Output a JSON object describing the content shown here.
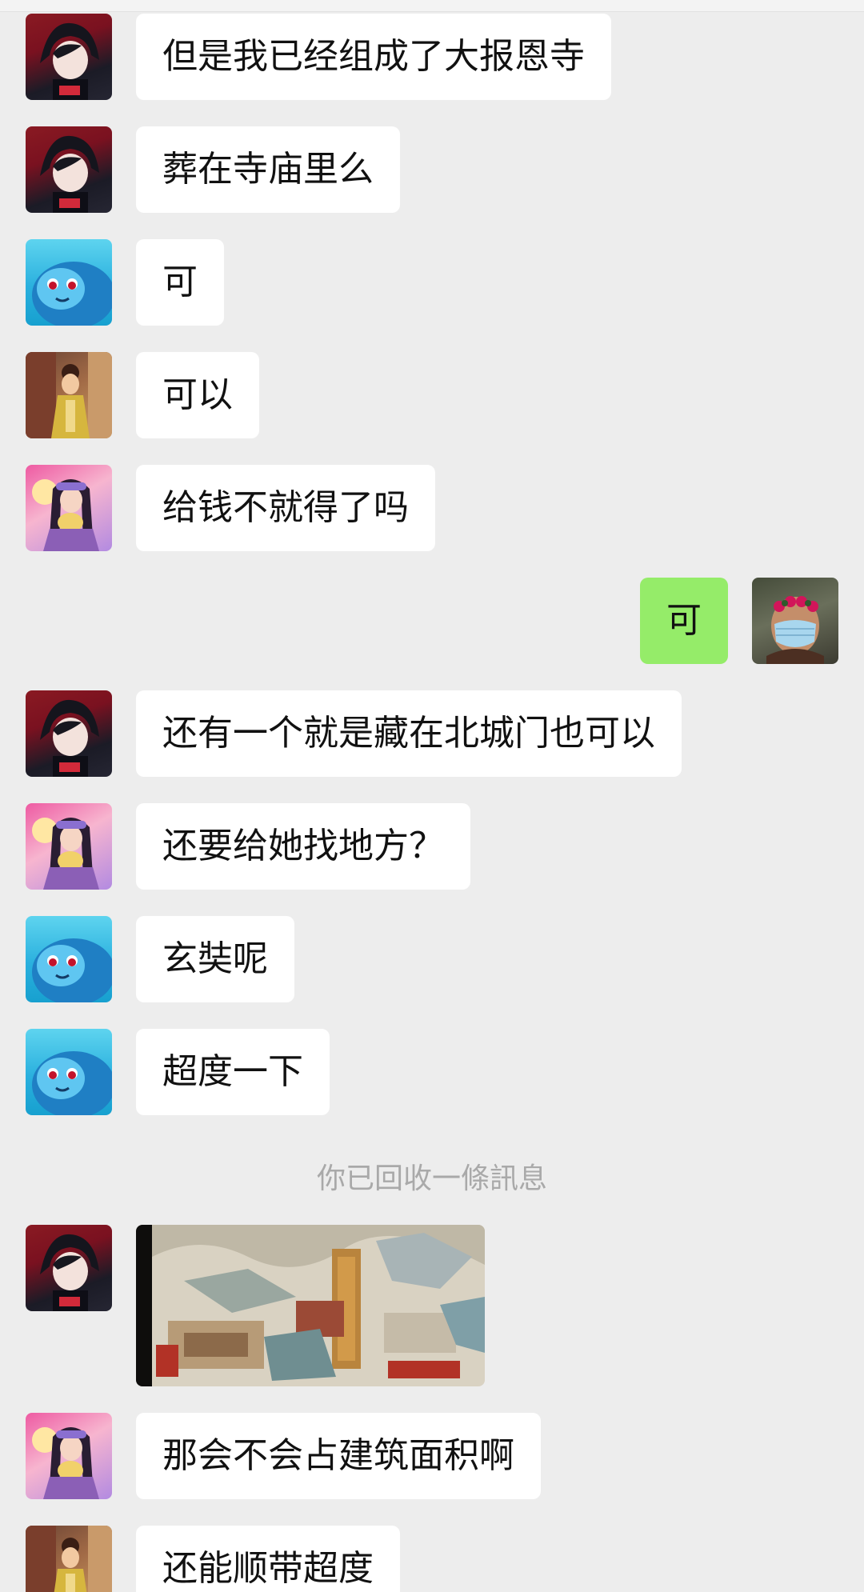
{
  "colors": {
    "background": "#ededed",
    "bubble_other": "#ffffff",
    "bubble_self": "#95ec69",
    "notice_text": "#a9a9a9"
  },
  "messages": [
    {
      "sender": "boy",
      "avatar_icon": "avatar-boy-icon",
      "text": "但是我已经组成了大报恩寺"
    },
    {
      "sender": "boy",
      "avatar_icon": "avatar-boy-icon",
      "text": "葬在寺庙里么"
    },
    {
      "sender": "whale",
      "avatar_icon": "avatar-whale-icon",
      "text": "可"
    },
    {
      "sender": "girl",
      "avatar_icon": "avatar-girl-icon",
      "text": "可以"
    },
    {
      "sender": "pink",
      "avatar_icon": "avatar-pink-icon",
      "text": "给钱不就得了吗"
    },
    {
      "sender": "me",
      "avatar_icon": "avatar-masked-icon",
      "text": "可"
    },
    {
      "sender": "boy",
      "avatar_icon": "avatar-boy-icon",
      "text": "还有一个就是藏在北城门也可以"
    },
    {
      "sender": "pink",
      "avatar_icon": "avatar-pink-icon",
      "text": "还要给她找地方？"
    },
    {
      "sender": "whale",
      "avatar_icon": "avatar-whale-icon",
      "text": "玄奘呢"
    },
    {
      "sender": "whale",
      "avatar_icon": "avatar-whale-icon",
      "text": "超度一下"
    },
    {
      "sender": "boy",
      "avatar_icon": "avatar-boy-icon",
      "text": "那会不会占建筑面积啊"
    },
    {
      "sender": "girl",
      "avatar_icon": "avatar-girl-icon",
      "text": "还能顺带超度"
    }
  ],
  "system_notice": "你已回收一條訊息",
  "image_message": {
    "sender": "boy",
    "thumbnail_icon": "game-map-thumbnail"
  }
}
